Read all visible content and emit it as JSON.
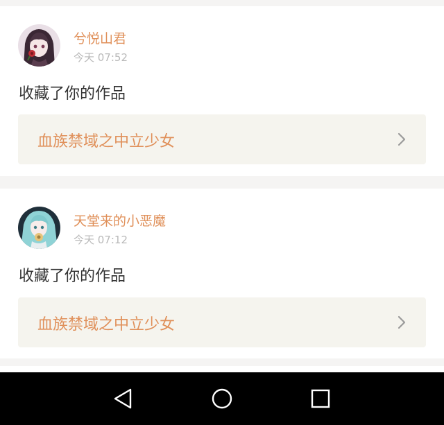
{
  "notifications": [
    {
      "avatar_icon": "anime-girl-avatar-icon",
      "username": "兮悦山君",
      "time": "今天 07:52",
      "action": "收藏了你的作品",
      "work_title": "血族禁域之中立少女"
    },
    {
      "avatar_icon": "anime-miku-avatar-icon",
      "username": "天堂来的小恶魔",
      "time": "今天 07:12",
      "action": "收藏了你的作品",
      "work_title": "血族禁域之中立少女"
    }
  ],
  "navbar": {
    "back_icon": "back-triangle-icon",
    "home_icon": "home-circle-icon",
    "recents_icon": "recents-square-icon"
  },
  "colors": {
    "accent": "#e0905a",
    "time_gray": "#b9b9b9",
    "work_box_bg": "#f5f4ee",
    "page_bg": "#f5f4f3"
  }
}
